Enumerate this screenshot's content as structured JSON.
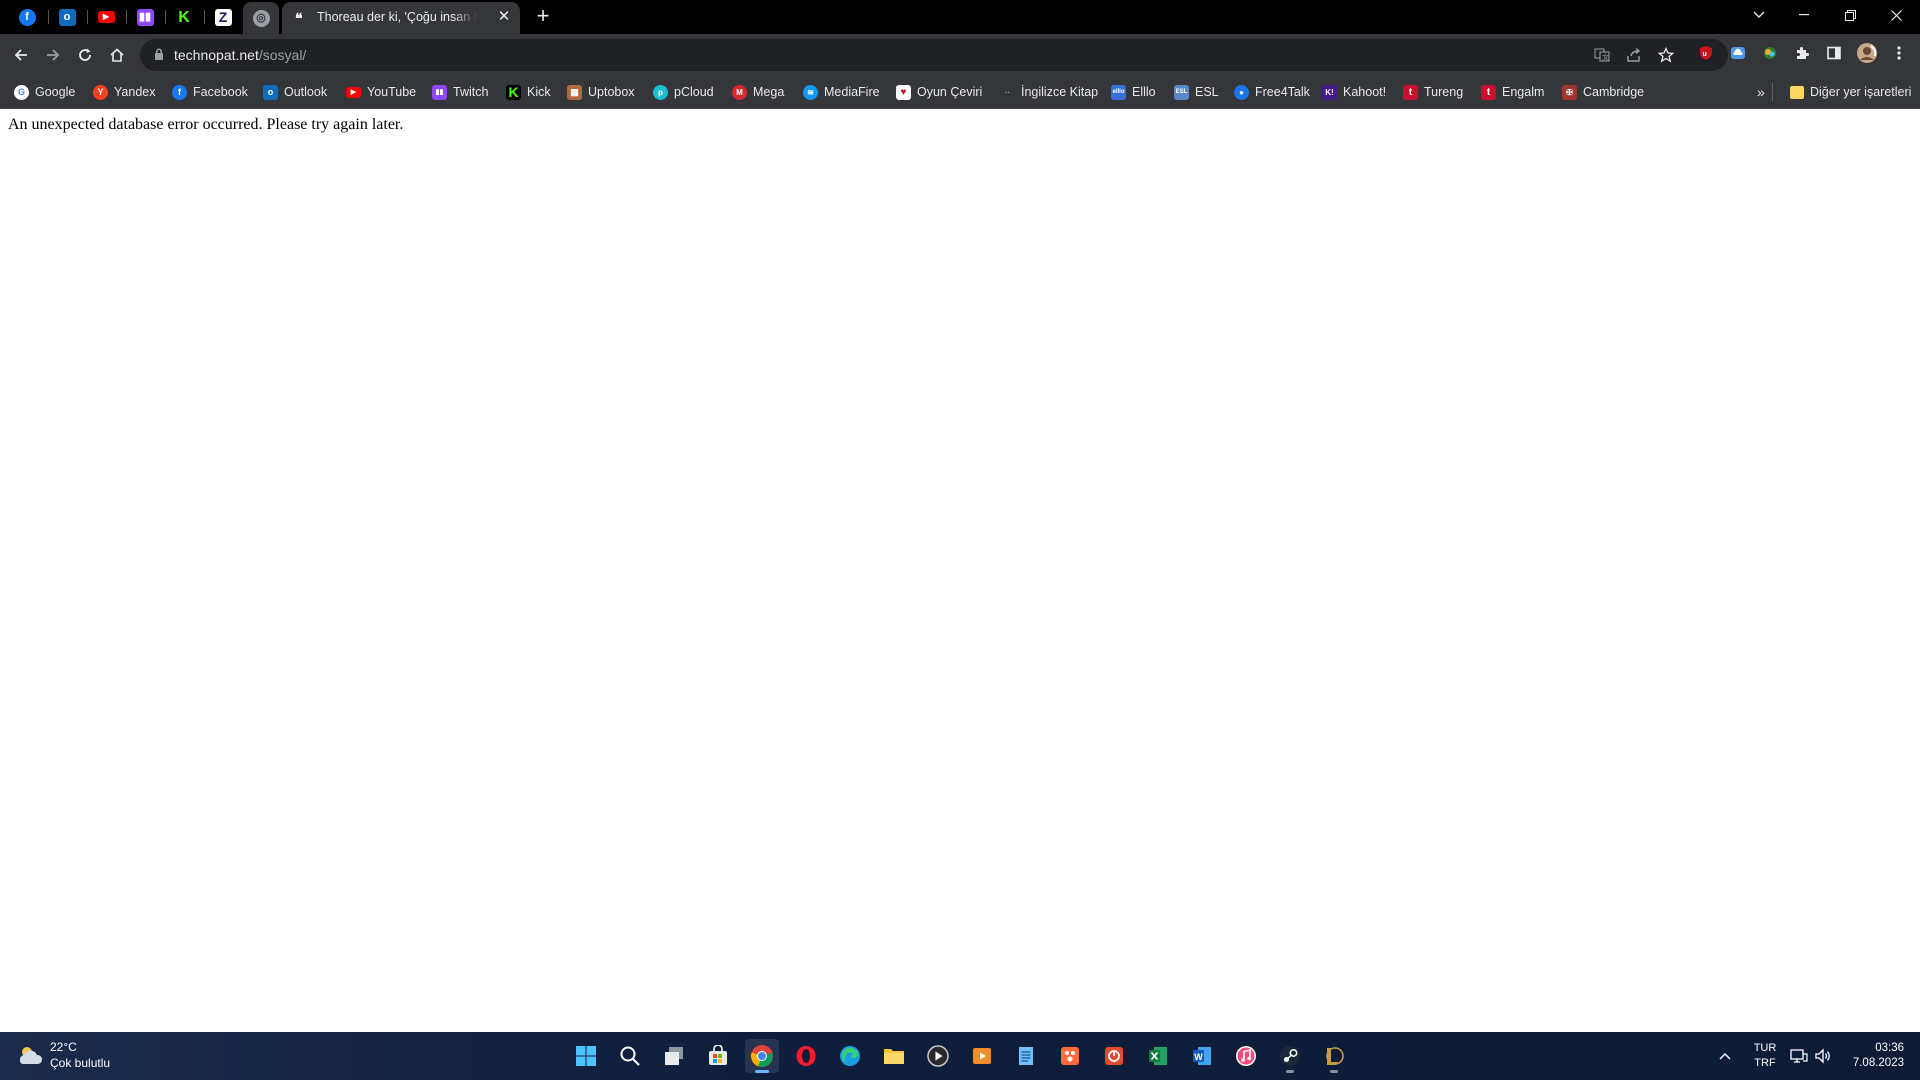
{
  "browser": {
    "pinned_tabs": [
      {
        "name": "Facebook",
        "icon": "facebook-icon",
        "color": "#1877f2"
      },
      {
        "name": "Outlook",
        "icon": "outlook-icon",
        "color": "#0f6cbd"
      },
      {
        "name": "YouTube",
        "icon": "youtube-icon",
        "color": "#ff0000"
      },
      {
        "name": "Twitch",
        "icon": "twitch-icon",
        "color": "#9146ff"
      },
      {
        "name": "Kick",
        "icon": "kick-icon",
        "color": "#53fc18"
      },
      {
        "name": "Zendesk-like",
        "icon": "zeta-icon",
        "color": "#7b2ff7"
      },
      {
        "name": "Chrome web",
        "icon": "globe-icon",
        "color": "#9aa0a6"
      }
    ],
    "active_tab": {
      "title": "Thoreau der ki, 'Çoğu insan hayatını sessiz bir umutsuzluk içinde geçirir'",
      "favicon": "quote-icon"
    },
    "address": {
      "host": "technopat.net",
      "path": "/sosyal/"
    },
    "bookmarks": [
      {
        "label": "Google",
        "icon": "google-icon",
        "color": "#ffffff"
      },
      {
        "label": "Yandex",
        "icon": "yandex-icon",
        "color": "#fc3f1d"
      },
      {
        "label": "Facebook",
        "icon": "facebook-icon",
        "color": "#1877f2"
      },
      {
        "label": "Outlook",
        "icon": "outlook-icon",
        "color": "#0f6cbd"
      },
      {
        "label": "YouTube",
        "icon": "youtube-icon",
        "color": "#ff0000"
      },
      {
        "label": "Twitch",
        "icon": "twitch-icon",
        "color": "#9146ff"
      },
      {
        "label": "Kick",
        "icon": "kick-icon",
        "color": "#53fc18"
      },
      {
        "label": "Uptobox",
        "icon": "box-icon",
        "color": "#b06a3b"
      },
      {
        "label": "pCloud",
        "icon": "pcloud-icon",
        "color": "#17bed0"
      },
      {
        "label": "Mega",
        "icon": "mega-icon",
        "color": "#d9272e"
      },
      {
        "label": "MediaFire",
        "icon": "mediafire-icon",
        "color": "#1299f3"
      },
      {
        "label": "Oyun Çeviri",
        "icon": "oyun-ceviri-icon",
        "color": "#ffffff"
      },
      {
        "label": "İngilizce Kitap",
        "icon": "book-icon",
        "color": "#4a4b4f"
      },
      {
        "label": "Elllo",
        "icon": "elllo-icon",
        "color": "#3b6fd8"
      },
      {
        "label": "ESL",
        "icon": "esl-icon",
        "color": "#5b88c8"
      },
      {
        "label": "Free4Talk",
        "icon": "free4talk-icon",
        "color": "#1a73e8"
      },
      {
        "label": "Kahoot!",
        "icon": "kahoot-icon",
        "color": "#46178f"
      },
      {
        "label": "Tureng",
        "icon": "tureng-icon",
        "color": "#c8102e"
      },
      {
        "label": "Engalm",
        "icon": "engalm-icon",
        "color": "#c8102e"
      },
      {
        "label": "Cambridge",
        "icon": "cambridge-icon",
        "color": "#a3342b"
      }
    ],
    "other_bookmarks": "Diğer yer işaretleri"
  },
  "page": {
    "message": "An unexpected database error occurred. Please try again later."
  },
  "taskbar": {
    "weather": {
      "temp": "22°C",
      "desc": "Çok bulutlu"
    },
    "apps": [
      {
        "name": "start-button",
        "icon": "windows-icon"
      },
      {
        "name": "search-button",
        "icon": "search-icon"
      },
      {
        "name": "task-view-button",
        "icon": "task-view-icon"
      },
      {
        "name": "store-app",
        "icon": "store-icon"
      },
      {
        "name": "chrome-app",
        "icon": "chrome-icon"
      },
      {
        "name": "opera-app",
        "icon": "opera-icon"
      },
      {
        "name": "edge-app",
        "icon": "edge-icon"
      },
      {
        "name": "explorer-app",
        "icon": "folder-icon"
      },
      {
        "name": "media-player-app",
        "icon": "play-icon"
      },
      {
        "name": "video-app",
        "icon": "video-icon"
      },
      {
        "name": "notepad-app",
        "icon": "notepad-icon"
      },
      {
        "name": "paint-app",
        "icon": "paint-icon"
      },
      {
        "name": "office-app",
        "icon": "office-icon"
      },
      {
        "name": "excel-app",
        "icon": "excel-icon"
      },
      {
        "name": "word-app",
        "icon": "word-icon"
      },
      {
        "name": "itunes-app",
        "icon": "music-icon"
      },
      {
        "name": "steam-app",
        "icon": "steam-icon"
      },
      {
        "name": "league-app",
        "icon": "league-icon"
      }
    ],
    "lang_line1": "TUR",
    "lang_line2": "TRF",
    "time": "03:36",
    "date": "7.08.2023"
  }
}
